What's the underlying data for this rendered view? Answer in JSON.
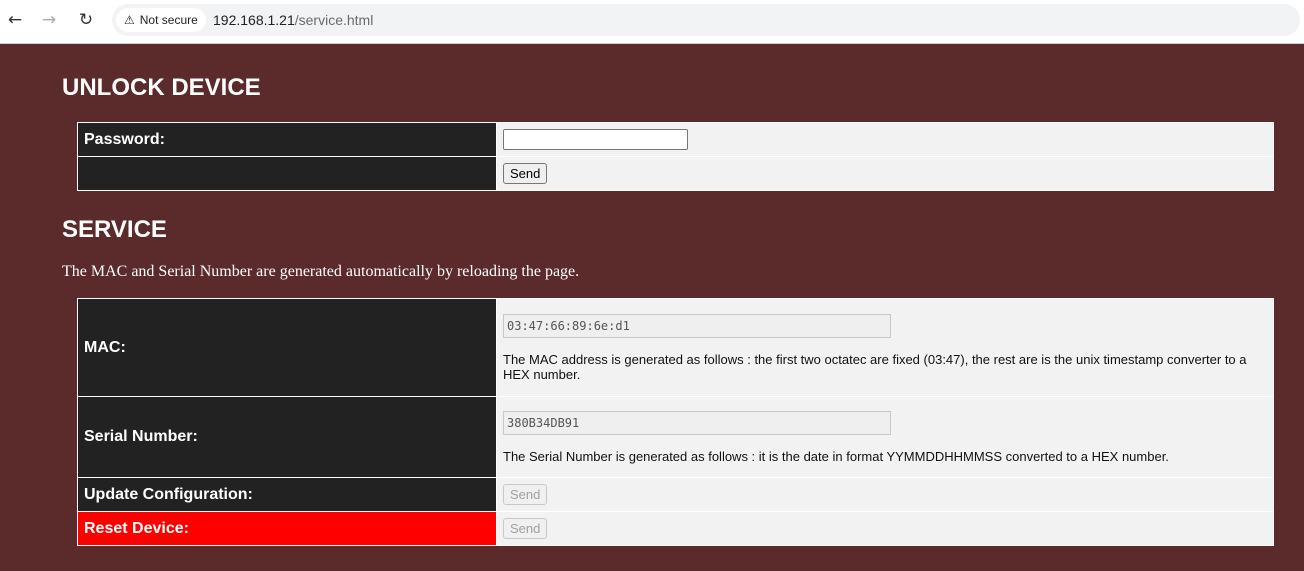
{
  "browser": {
    "back_icon": "←",
    "forward_icon": "→",
    "reload_icon": "↻",
    "security_icon": "⚠",
    "security_label": "Not secure",
    "url_host": "192.168.1.21",
    "url_path": "/service.html"
  },
  "unlock": {
    "title": "UNLOCK DEVICE",
    "password_label": "Password:",
    "password_value": "",
    "send_label": "Send"
  },
  "service": {
    "title": "SERVICE",
    "description": "The MAC and Serial Number are generated automatically by reloading the page.",
    "mac_label": "MAC:",
    "mac_value": "03:47:66:89:6e:d1",
    "mac_help": "The MAC address is generated as follows : the first two octatec are fixed (03:47), the rest are is the unix timestamp converter to a HEX number.",
    "serial_label": "Serial Number:",
    "serial_value": "380B34DB91",
    "serial_help": "The Serial Number is generated as follows : it is the date in format YYMMDDHHMMSS converted to a HEX number.",
    "update_label": "Update Configuration:",
    "update_button": "Send",
    "reset_label": "Reset Device:",
    "reset_button": "Send"
  }
}
